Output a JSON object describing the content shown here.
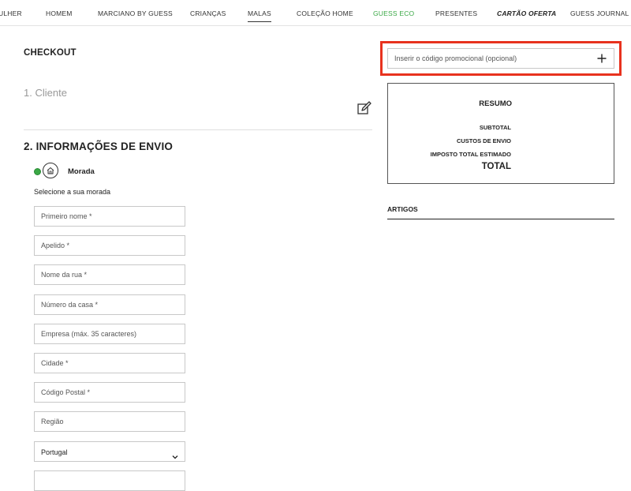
{
  "nav": {
    "items": [
      {
        "label": "ULHER"
      },
      {
        "label": "HOMEM"
      },
      {
        "label": "MARCIANO BY GUESS"
      },
      {
        "label": "CRIANÇAS"
      },
      {
        "label": "MALAS"
      },
      {
        "label": "COLEÇÃO HOME"
      },
      {
        "label": "GUESS ECO"
      },
      {
        "label": "PRESENTES"
      },
      {
        "label": "CARTÃO OFERTA"
      },
      {
        "label": "GUESS JOURNAL"
      }
    ],
    "active": "MALAS",
    "eco_color": "#3aa845"
  },
  "checkout": {
    "title": "CHECKOUT",
    "section1": "1. Cliente",
    "section2": "2. INFORMAÇÕES DE ENVIO",
    "address_option": "Morada",
    "select_address": "Selecione a sua morada",
    "fields": [
      {
        "placeholder": "Primeiro nome *"
      },
      {
        "placeholder": "Apelido *"
      },
      {
        "placeholder": "Nome da rua *"
      },
      {
        "placeholder": "Número da casa *"
      },
      {
        "placeholder": "Empresa (máx. 35 caracteres)"
      },
      {
        "placeholder": "Cidade *"
      },
      {
        "placeholder": "Código Postal *"
      },
      {
        "placeholder": "Região"
      }
    ],
    "country": "Portugal",
    "radio_color": "#3aa845"
  },
  "promo": {
    "placeholder": "Inserir o código promocional (opcional)",
    "highlight_color": "#e8321e"
  },
  "summary": {
    "title": "RESUMO",
    "subtotal": "SUBTOTAL",
    "shipping": "CUSTOS DE ENVIO",
    "tax": "IMPOSTO TOTAL ESTIMADO",
    "total": "TOTAL"
  },
  "articles": {
    "title": "ARTIGOS"
  },
  "icons": {
    "edit": "edit-icon",
    "home": "home-icon",
    "plus": "plus-icon",
    "chevron": "chevron-down-icon"
  }
}
